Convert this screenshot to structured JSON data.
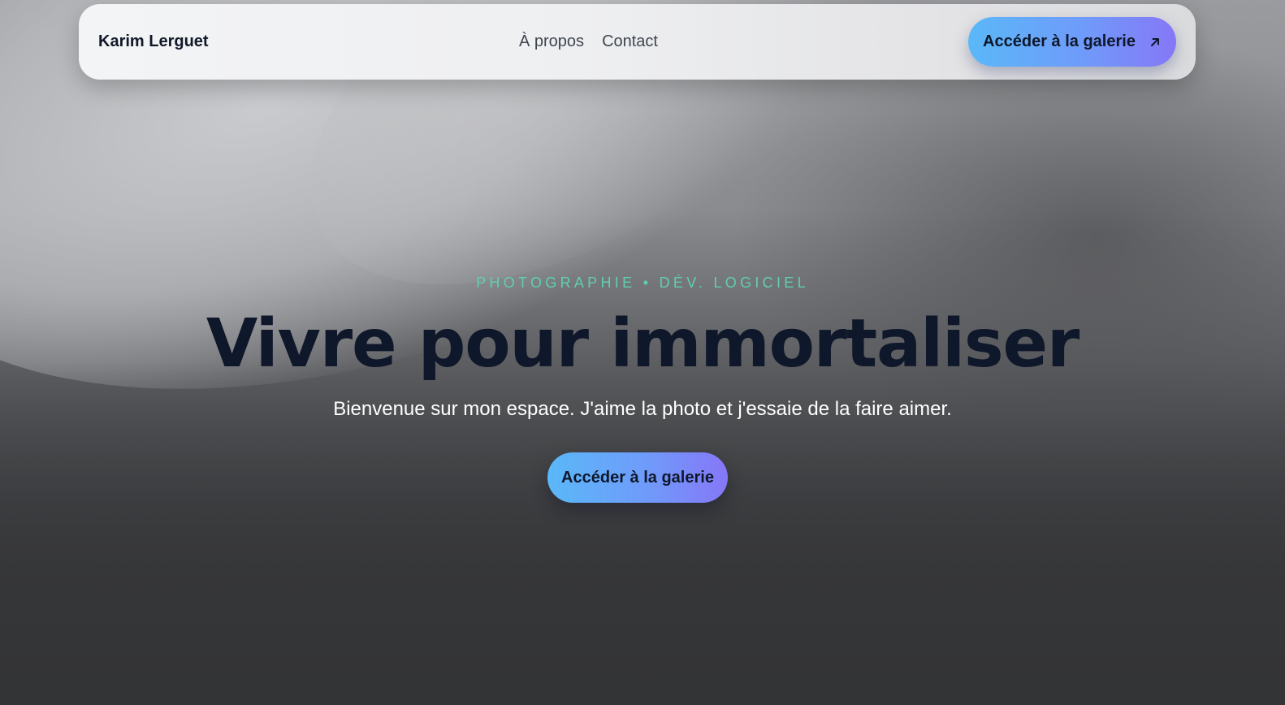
{
  "navbar": {
    "brand": "Karim Lerguet",
    "links": [
      {
        "label": "À propos"
      },
      {
        "label": "Contact"
      }
    ],
    "cta": {
      "label": "Accéder à la galerie",
      "icon": "arrow-up-right-icon"
    }
  },
  "hero": {
    "eyebrow": "PHOTOGRAPHIE • DÉV. LOGICIEL",
    "headline": "Vivre pour immortaliser",
    "subtitle": "Bienvenue sur mon espace. J'aime la photo et j'essaie de la faire aimer.",
    "cta_label": "Accéder à la galerie"
  },
  "colors": {
    "accent_gradient_start": "#5ab8f8",
    "accent_gradient_end": "#8677f7",
    "eyebrow": "#5fcfb1",
    "headline": "#0f172a"
  }
}
